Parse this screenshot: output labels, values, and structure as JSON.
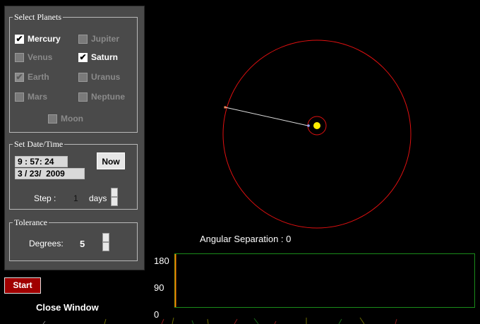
{
  "panel": {
    "select_planets": {
      "legend": "Select Planets",
      "planets": [
        {
          "label": "Mercury",
          "checked": true,
          "disabled": false
        },
        {
          "label": "Jupiter",
          "checked": false,
          "disabled": false
        },
        {
          "label": "Venus",
          "checked": false,
          "disabled": false
        },
        {
          "label": "Saturn",
          "checked": true,
          "disabled": false
        },
        {
          "label": "Earth",
          "checked": true,
          "disabled": true
        },
        {
          "label": "Uranus",
          "checked": false,
          "disabled": false
        },
        {
          "label": "Mars",
          "checked": false,
          "disabled": false
        },
        {
          "label": "Neptune",
          "checked": false,
          "disabled": false
        }
      ],
      "moon": {
        "label": "Moon",
        "checked": false,
        "disabled": false
      }
    },
    "datetime": {
      "legend": "Set Date/Time",
      "hour": "9",
      "minute": "57",
      "second": "24",
      "month": "3",
      "day": "23",
      "year": "2009",
      "time_sep": ":",
      "date_sep": "/",
      "now_label": "Now",
      "step_label": "Step :",
      "step_value": "1",
      "step_unit": "days"
    },
    "tolerance": {
      "legend": "Tolerance",
      "degrees_label": "Degrees:",
      "degrees_value": "5"
    }
  },
  "start_label": "Start",
  "close_label": "Close Window",
  "angular_separation": "Angular Separation : 0",
  "graph": {
    "y_ticks": [
      "180",
      "90",
      "0"
    ],
    "border_color": "#1a8c1a"
  },
  "colors": {
    "orbit": "#e01010",
    "sun": "#ffee00",
    "line": "#dcdcdc",
    "start_bg": "#a00000"
  }
}
